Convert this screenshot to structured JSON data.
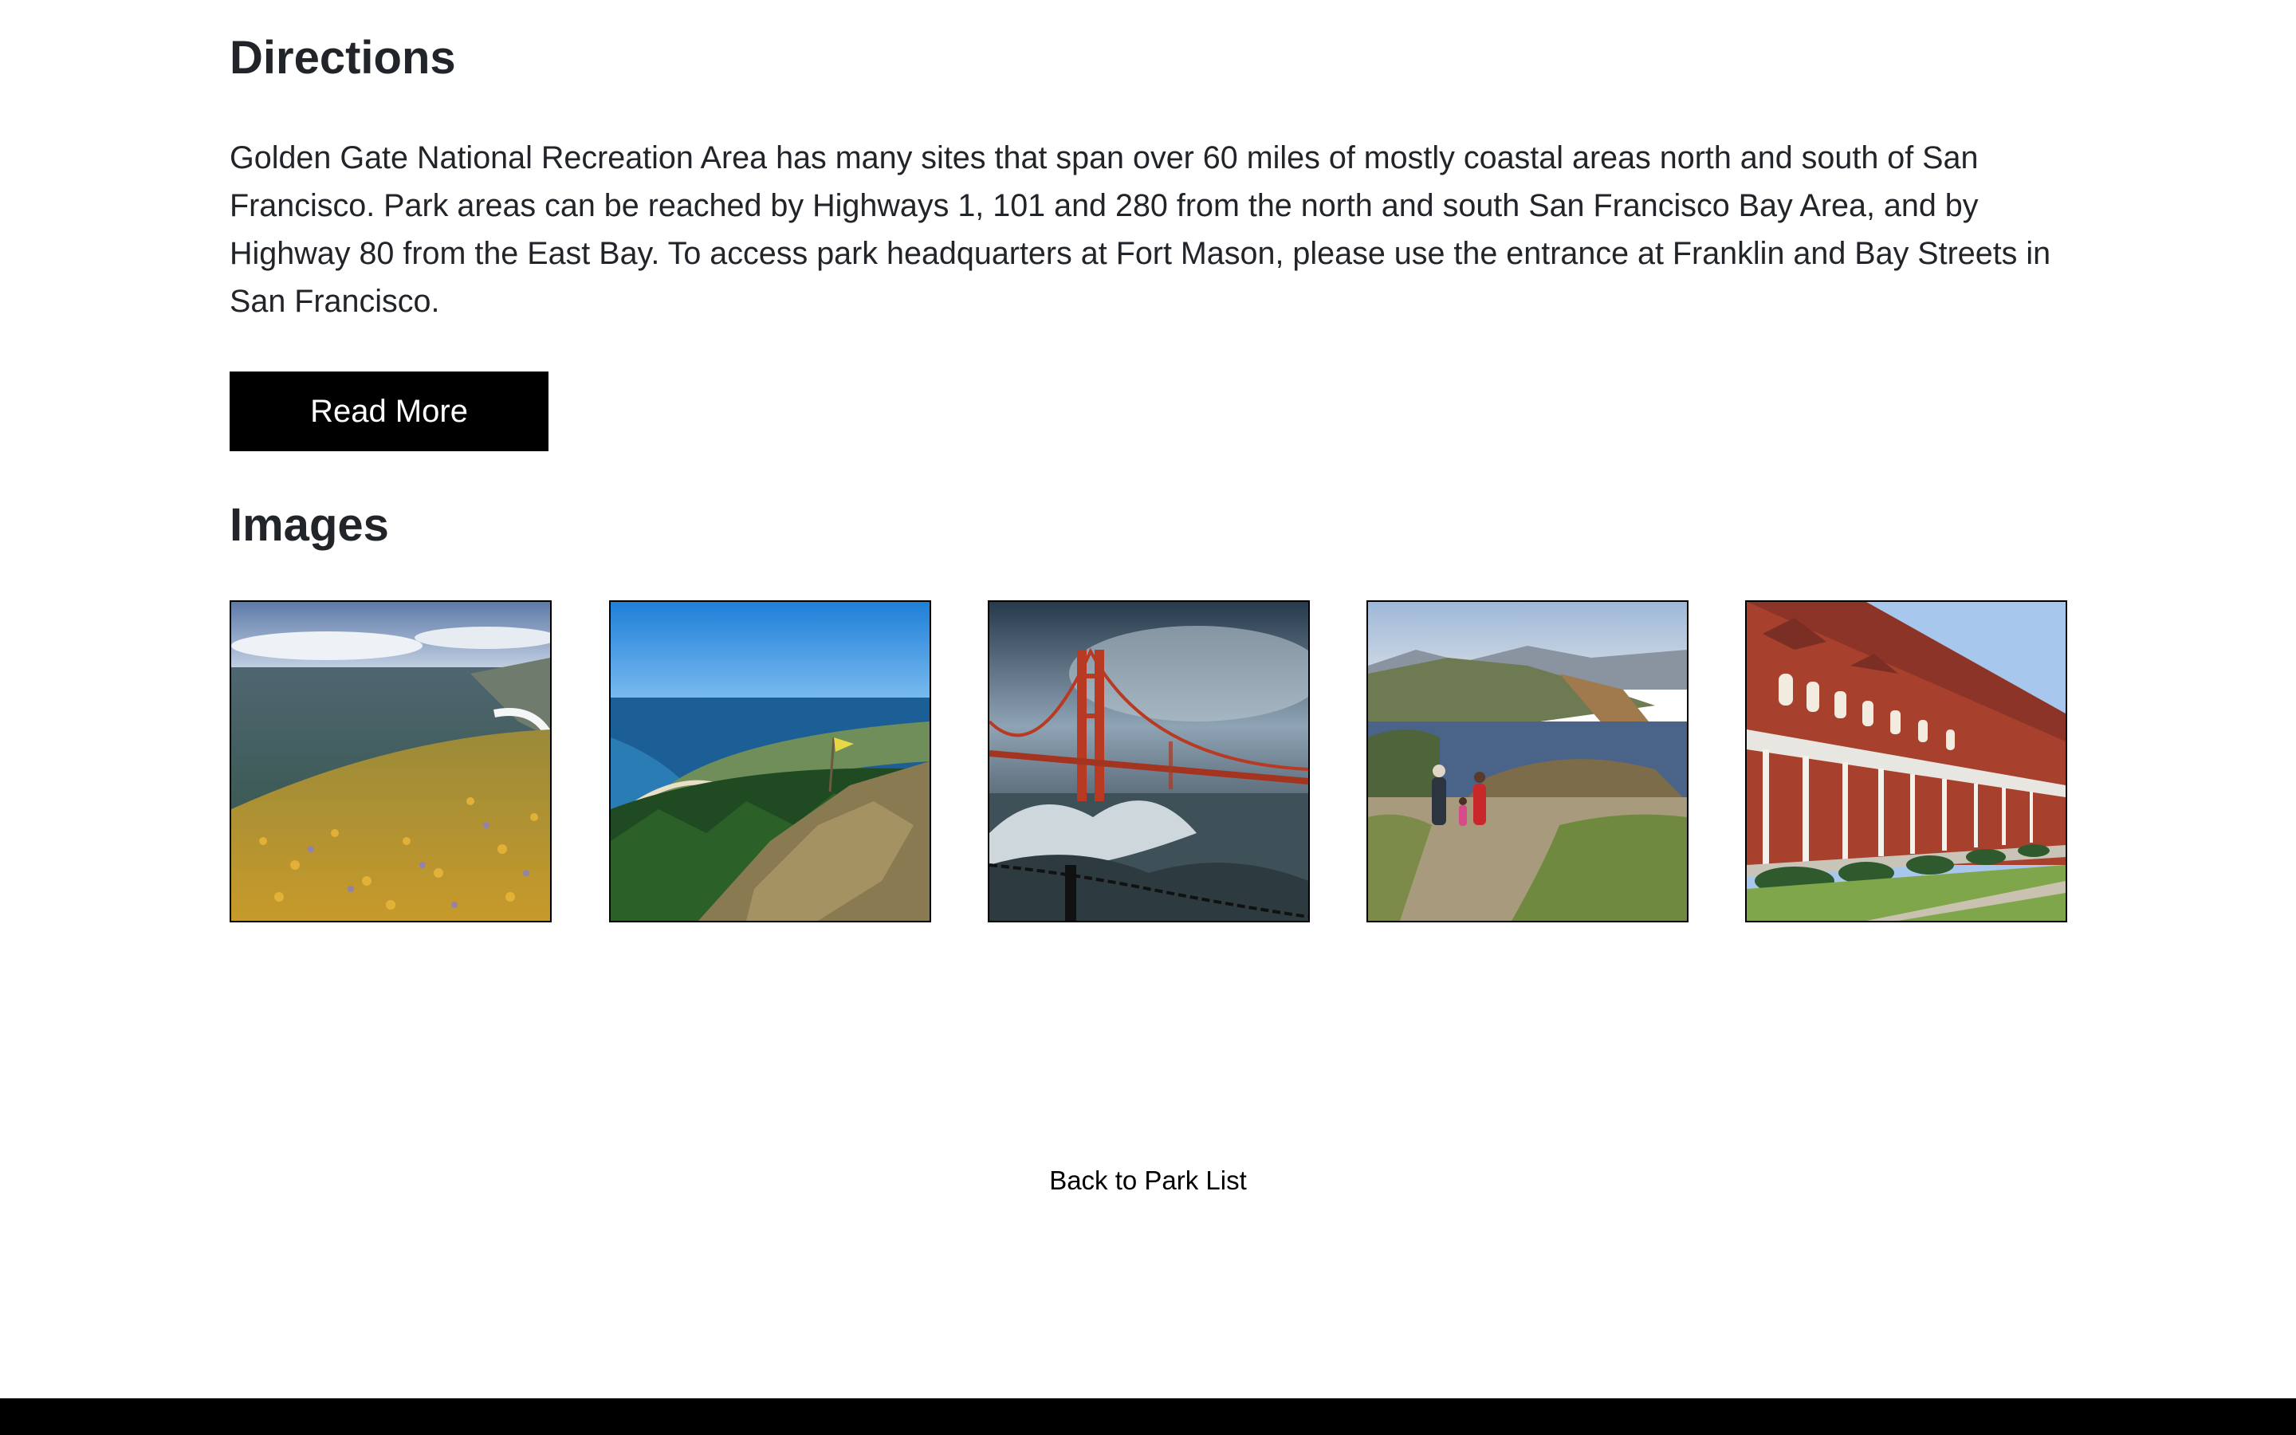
{
  "directions": {
    "title": "Directions",
    "text": "Golden Gate National Recreation Area has many sites that span over 60 miles of mostly coastal areas north and south of San Francisco. Park areas can be reached by Highways 1, 101 and 280 from the north and south San Francisco Bay Area, and by Highway 80 from the East Bay. To access park headquarters at Fort Mason, please use the entrance at Franklin and Bay Streets in San Francisco.",
    "read_more_label": "Read More"
  },
  "images": {
    "title": "Images",
    "items": [
      {
        "icon": "wildflower-hillside-ocean-photo"
      },
      {
        "icon": "coastal-overlook-beach-photo"
      },
      {
        "icon": "golden-gate-bridge-waves-photo"
      },
      {
        "icon": "hikers-coastal-trail-photo"
      },
      {
        "icon": "presidio-red-brick-barracks-photo"
      }
    ]
  },
  "footer": {
    "back_link_label": "Back to Park List"
  },
  "colors": {
    "text": "#212529",
    "button_bg": "#000000",
    "button_text": "#ffffff",
    "footer_bar": "#000000"
  }
}
